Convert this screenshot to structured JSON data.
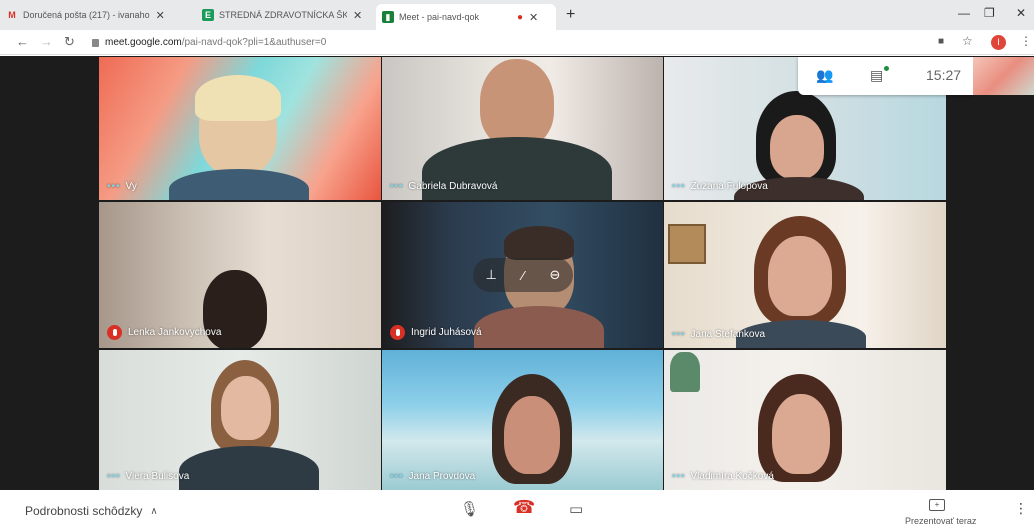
{
  "browser": {
    "tabs": [
      {
        "title": "Doručená pošta (217) - ivanaho",
        "favicon": "M",
        "favicon_color": "#d93025"
      },
      {
        "title": "STREDNÁ ZDRAVOTNÍCKA ŠKOL",
        "favicon": "E",
        "favicon_color": "#1a9b5a"
      },
      {
        "title": "Meet - pai-navd-qok",
        "favicon": "▮",
        "favicon_color": "#188038"
      }
    ],
    "url_host": "meet.google.com",
    "url_path": "/pai-navd-qok?pli=1&authuser=0",
    "profile_initial": "I"
  },
  "meeting": {
    "time": "15:27",
    "participants": [
      {
        "name": "Vy",
        "muted": false
      },
      {
        "name": "Gabriela Dubravová",
        "muted": false
      },
      {
        "name": "Zuzana Fulopova",
        "muted": false
      },
      {
        "name": "Lenka Jankovychova",
        "muted": true
      },
      {
        "name": "Ingrid Juhásová",
        "muted": true
      },
      {
        "name": "Jana Stefankova",
        "muted": false
      },
      {
        "name": "Viera Bulisova",
        "muted": false
      },
      {
        "name": "Jana Provdova",
        "muted": false
      },
      {
        "name": "Vladimíra Kočková",
        "muted": false
      }
    ]
  },
  "controls": {
    "details_label": "Podrobnosti schôdzky",
    "present_label": "Prezentovať teraz"
  }
}
